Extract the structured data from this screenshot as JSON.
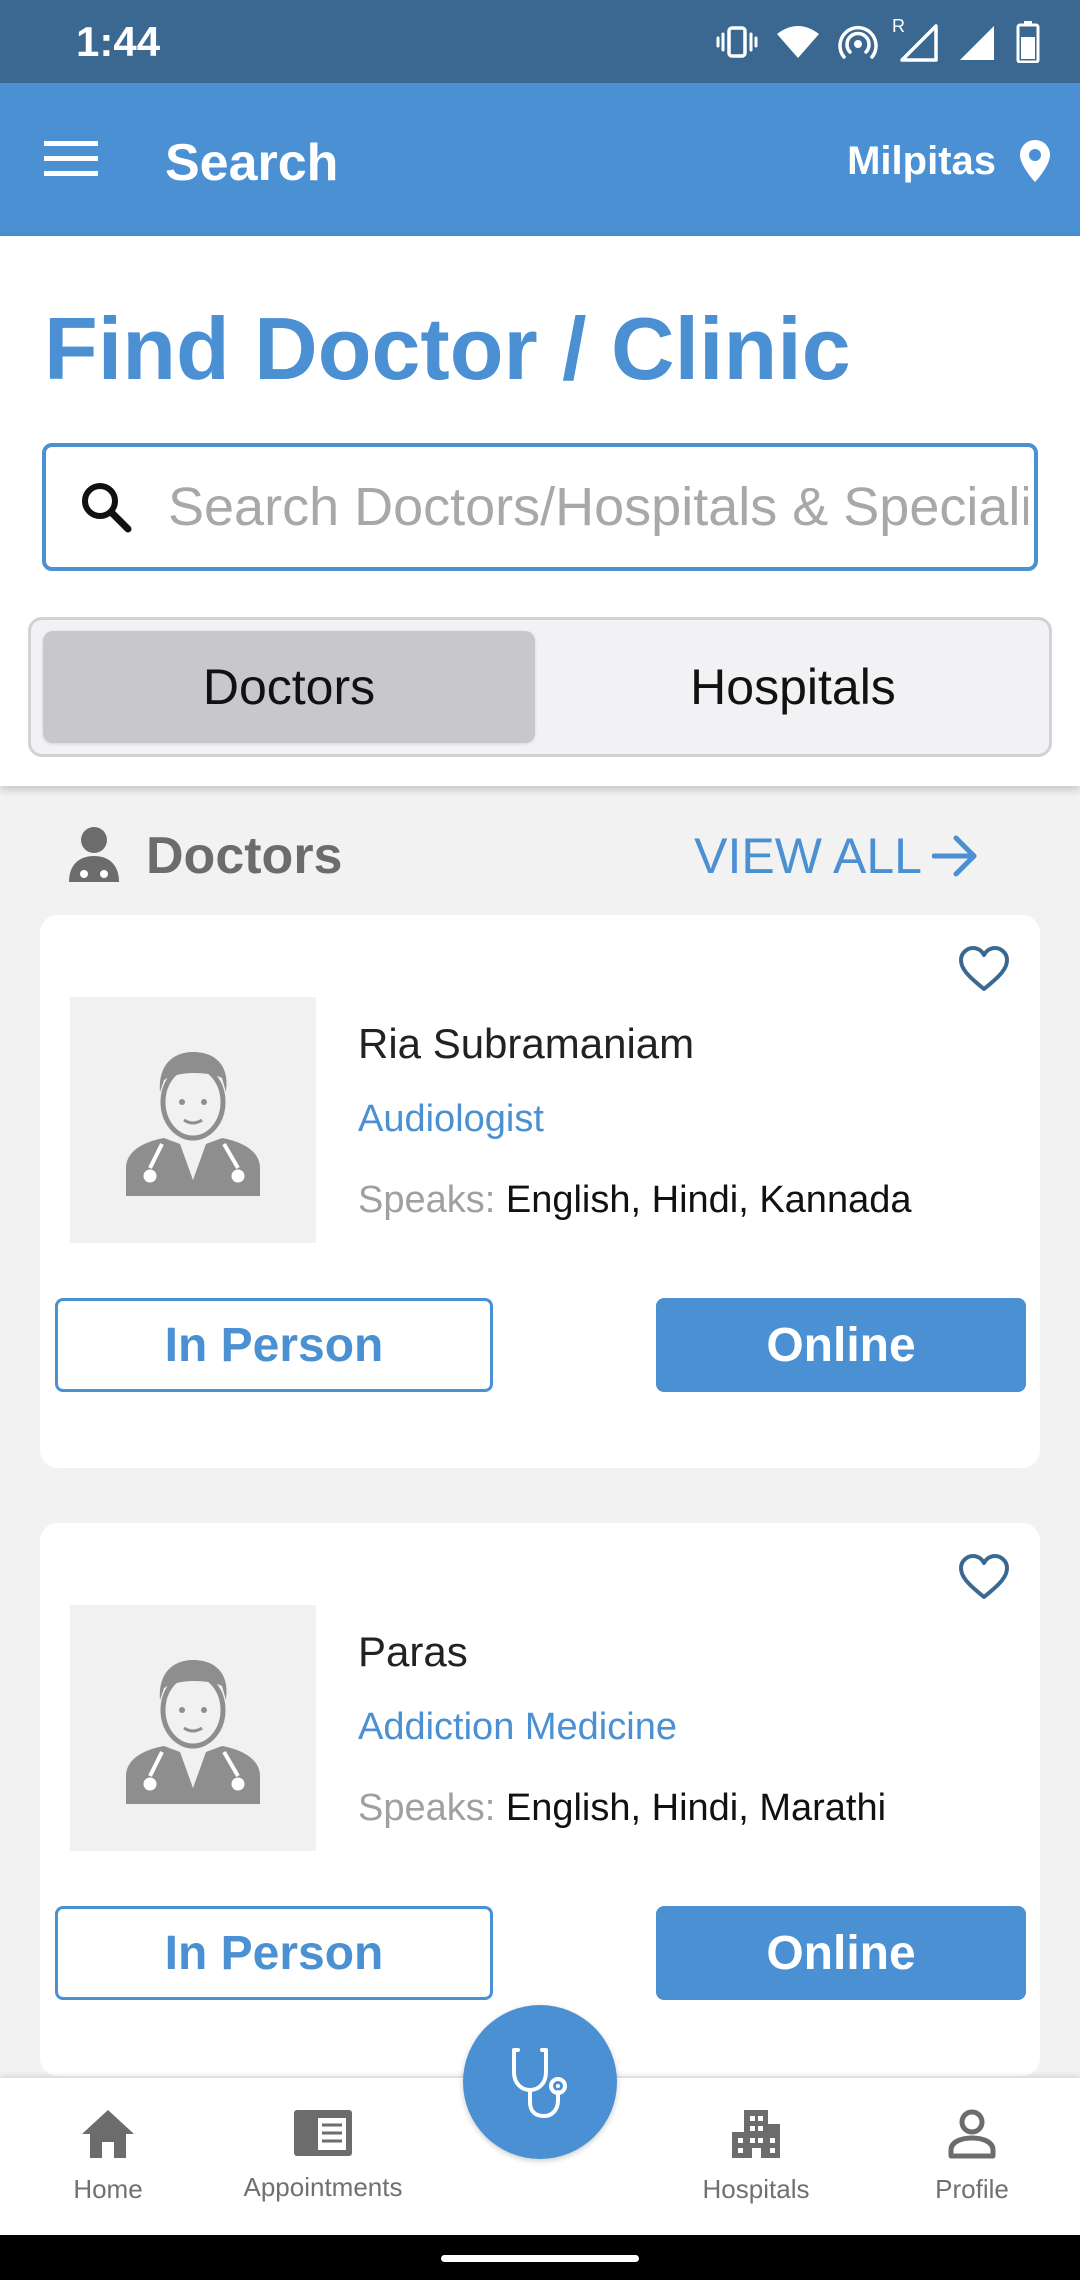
{
  "status_bar": {
    "time": "1:44",
    "icons": [
      "vibrate-icon",
      "wifi-icon",
      "hotspot-icon",
      "signal-roaming-icon",
      "signal-icon",
      "battery-icon"
    ],
    "roaming_mark": "R"
  },
  "app_bar": {
    "title": "Search",
    "location": "Milpitas",
    "menu_icon": "hamburger-menu-icon",
    "location_icon": "location-pin-icon"
  },
  "search": {
    "heading": "Find Doctor / Clinic",
    "placeholder": "Search Doctors/Hospitals & Specialities",
    "value": ""
  },
  "segments": {
    "selected": "Doctors",
    "items": [
      "Doctors",
      "Hospitals"
    ]
  },
  "section": {
    "title": "Doctors",
    "view_all": "VIEW ALL",
    "icon": "doctor-icon"
  },
  "doctors": [
    {
      "name": "Ria Subramaniam",
      "specialty": "Audiologist",
      "speaks_label": "Speaks:",
      "languages": "English, Hindi, Kannada",
      "in_person_label": "In Person",
      "online_label": "Online"
    },
    {
      "name": "Paras",
      "specialty": "Addiction Medicine",
      "speaks_label": "Speaks:",
      "languages": "English, Hindi, Marathi",
      "in_person_label": "In Person",
      "online_label": "Online"
    }
  ],
  "bottom_nav": {
    "items": [
      {
        "label": "Home",
        "icon": "home-icon"
      },
      {
        "label": "Appointments",
        "icon": "appointments-icon"
      },
      {
        "label": "Hospitals",
        "icon": "hospital-building-icon"
      },
      {
        "label": "Profile",
        "icon": "profile-icon"
      }
    ],
    "fab_icon": "stethoscope-icon"
  },
  "colors": {
    "primary": "#4a90d2",
    "status_bar": "#3a6891",
    "background": "#f2f2f2",
    "segment_selected": "#c8c8cc",
    "muted_text": "#a0a0a0"
  }
}
